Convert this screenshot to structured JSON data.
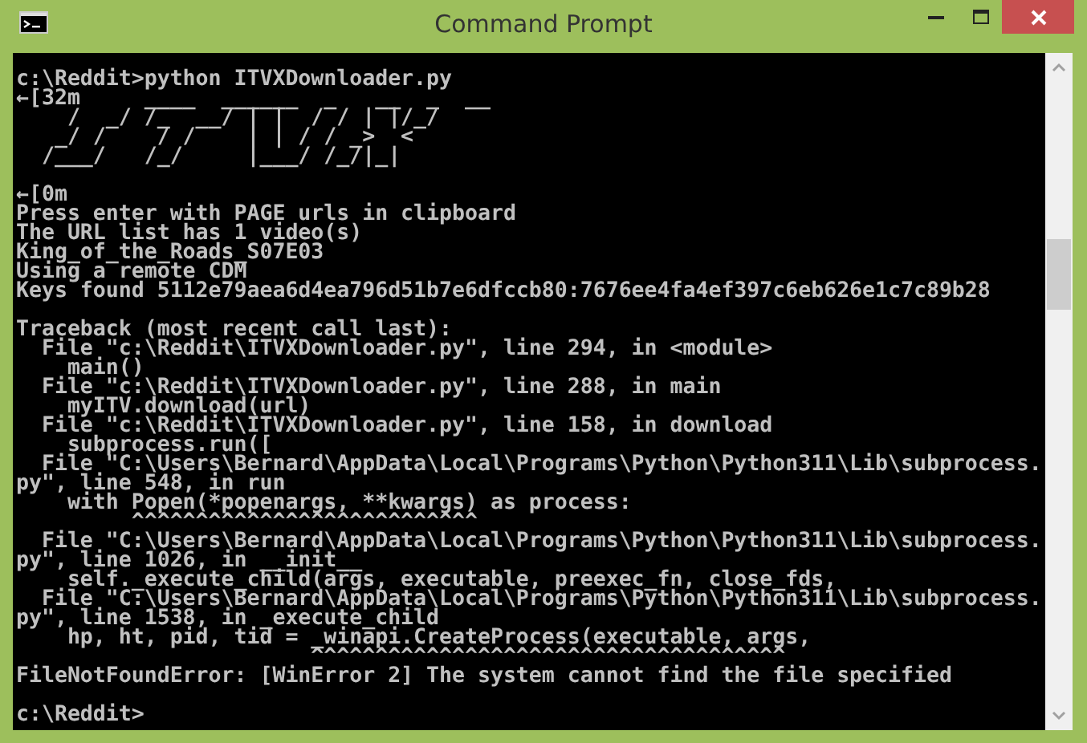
{
  "window": {
    "title": "Command Prompt"
  },
  "console": {
    "lines": [
      {
        "kind": "text",
        "text": "c:\\Reddit>python ITVXDownloader.py"
      },
      {
        "kind": "text",
        "text": "←[32m     ____  ______  _   __  _  __"
      },
      {
        "kind": "text",
        "text": "    /  _/ /_  __/ | |  / / | |/_/"
      },
      {
        "kind": "text",
        "text": "   _/ /    / /    | | / / _>  <"
      },
      {
        "kind": "text",
        "text": "  /___/   /_/     |___/ /_/|_|"
      },
      {
        "kind": "blank"
      },
      {
        "kind": "text",
        "text": "←[0m"
      },
      {
        "kind": "text",
        "text": "Press enter with PAGE urls in clipboard"
      },
      {
        "kind": "text",
        "text": "The URL list has 1 video(s)"
      },
      {
        "kind": "text",
        "text": "King_of_the_Roads_S07E03"
      },
      {
        "kind": "text",
        "text": "Using a remote CDM"
      },
      {
        "kind": "text",
        "text": "Keys found 5112e79aea6d4ea796d51b7e6dfccb80:7676ee4fa4ef397c6eb626e1c7c89b28"
      },
      {
        "kind": "blank"
      },
      {
        "kind": "text",
        "text": "Traceback (most recent call last):"
      },
      {
        "kind": "text",
        "text": "  File \"c:\\Reddit\\ITVXDownloader.py\", line 294, in <module>"
      },
      {
        "kind": "text",
        "text": "    main()"
      },
      {
        "kind": "text",
        "text": "  File \"c:\\Reddit\\ITVXDownloader.py\", line 288, in main"
      },
      {
        "kind": "text",
        "text": "    myITV.download(url)"
      },
      {
        "kind": "text",
        "text": "  File \"c:\\Reddit\\ITVXDownloader.py\", line 158, in download"
      },
      {
        "kind": "text",
        "text": "    subprocess.run(["
      },
      {
        "kind": "text",
        "text": "  File \"C:\\Users\\Bernard\\AppData\\Local\\Programs\\Python\\Python311\\Lib\\subprocess."
      },
      {
        "kind": "text",
        "text": "py\", line 548, in run"
      },
      {
        "kind": "text",
        "text": "    with Popen(*popenargs, **kwargs) as process:"
      },
      {
        "kind": "text",
        "text": "         ^^^^^^^^^^^^^^^^^^^^^^^^^^^"
      },
      {
        "kind": "text",
        "text": "  File \"C:\\Users\\Bernard\\AppData\\Local\\Programs\\Python\\Python311\\Lib\\subprocess."
      },
      {
        "kind": "text",
        "text": "py\", line 1026, in __init__"
      },
      {
        "kind": "text",
        "text": "    self._execute_child(args, executable, preexec_fn, close_fds,"
      },
      {
        "kind": "text",
        "text": "  File \"C:\\Users\\Bernard\\AppData\\Local\\Programs\\Python\\Python311\\Lib\\subprocess."
      },
      {
        "kind": "text",
        "text": "py\", line 1538, in _execute_child"
      },
      {
        "kind": "text",
        "text": "    hp, ht, pid, tid = _winapi.CreateProcess(executable, args,"
      },
      {
        "kind": "text",
        "text": "                       ^^^^^^^^^^^^^^^^^^^^^^^^^^^^^^^^^^^^^"
      },
      {
        "kind": "text",
        "text": "FileNotFoundError: [WinError 2] The system cannot find the file specified"
      },
      {
        "kind": "blank"
      },
      {
        "kind": "text",
        "text": "c:\\Reddit>"
      }
    ]
  }
}
